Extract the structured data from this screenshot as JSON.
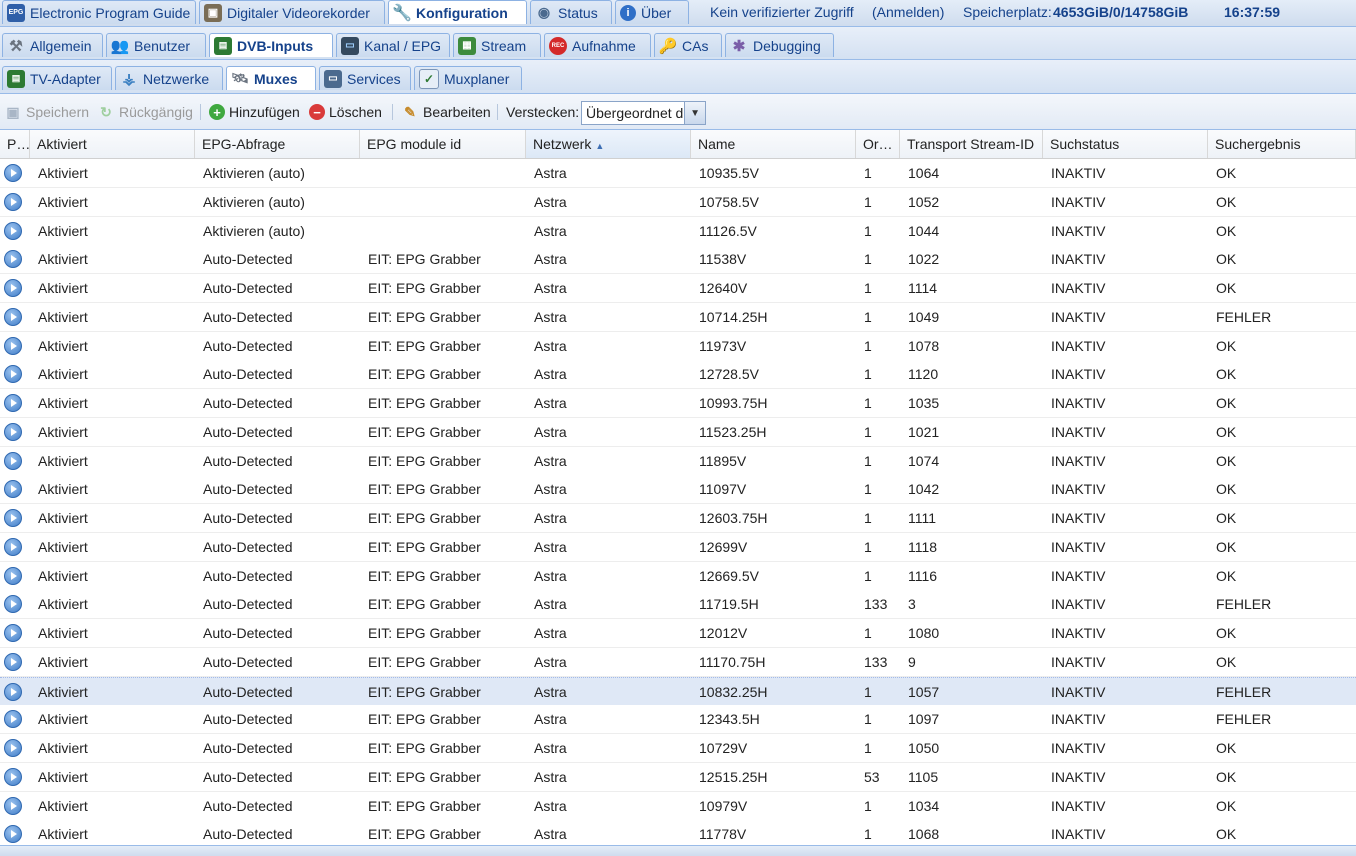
{
  "topbar": {
    "tabs": [
      {
        "label": "Electronic Program Guide",
        "icon": "epg-icon"
      },
      {
        "label": "Digitaler Videorekorder",
        "icon": "dvr-icon"
      },
      {
        "label": "Konfiguration",
        "icon": "wrench-icon",
        "active": true
      },
      {
        "label": "Status",
        "icon": "eye-icon"
      },
      {
        "label": "Über",
        "icon": "info-icon"
      }
    ],
    "access_text": "Kein verifizierter Zugriff",
    "login_link": "(Anmelden)",
    "storage_label": "Speicherplatz:",
    "storage_value": "4653GiB/0/14758GiB",
    "clock": "16:37:59"
  },
  "config_tabs": [
    {
      "label": "Allgemein",
      "icon": "tools-icon"
    },
    {
      "label": "Benutzer",
      "icon": "users-icon"
    },
    {
      "label": "DVB-Inputs",
      "icon": "dvb-card-icon",
      "active": true
    },
    {
      "label": "Kanal / EPG",
      "icon": "tv-icon"
    },
    {
      "label": "Stream",
      "icon": "stream-icon"
    },
    {
      "label": "Aufnahme",
      "icon": "rec-icon"
    },
    {
      "label": "CAs",
      "icon": "key-icon"
    },
    {
      "label": "Debugging",
      "icon": "bug-icon"
    }
  ],
  "dvb_tabs": [
    {
      "label": "TV-Adapter",
      "icon": "adapter-icon"
    },
    {
      "label": "Netzwerke",
      "icon": "antenna-icon"
    },
    {
      "label": "Muxes",
      "icon": "satellite-icon",
      "active": true
    },
    {
      "label": "Services",
      "icon": "services-icon"
    },
    {
      "label": "Muxplaner",
      "icon": "calendar-icon"
    }
  ],
  "toolbar": {
    "save": "Speichern",
    "undo": "Rückgängig",
    "add": "Hinzufügen",
    "delete": "Löschen",
    "edit": "Bearbeiten",
    "hide_label": "Verstecken:",
    "hide_value": "Übergeordnet d"
  },
  "columns": [
    "P…",
    "Aktiviert",
    "EPG-Abfrage",
    "EPG module id",
    "Netzwerk",
    "Name",
    "Or…",
    "Transport Stream-ID",
    "Suchstatus",
    "Suchergebnis"
  ],
  "sorted_column_index": 4,
  "rows": [
    [
      "Aktiviert",
      "Aktivieren (auto)",
      "",
      "Astra",
      "10935.5V",
      "1",
      "1064",
      "INAKTIV",
      "OK"
    ],
    [
      "Aktiviert",
      "Aktivieren (auto)",
      "",
      "Astra",
      "10758.5V",
      "1",
      "1052",
      "INAKTIV",
      "OK"
    ],
    [
      "Aktiviert",
      "Aktivieren (auto)",
      "",
      "Astra",
      "11126.5V",
      "1",
      "1044",
      "INAKTIV",
      "OK"
    ],
    [
      "Aktiviert",
      "Auto-Detected",
      "EIT: EPG Grabber",
      "Astra",
      "11538V",
      "1",
      "1022",
      "INAKTIV",
      "OK"
    ],
    [
      "Aktiviert",
      "Auto-Detected",
      "EIT: EPG Grabber",
      "Astra",
      "12640V",
      "1",
      "1114",
      "INAKTIV",
      "OK"
    ],
    [
      "Aktiviert",
      "Auto-Detected",
      "EIT: EPG Grabber",
      "Astra",
      "10714.25H",
      "1",
      "1049",
      "INAKTIV",
      "FEHLER"
    ],
    [
      "Aktiviert",
      "Auto-Detected",
      "EIT: EPG Grabber",
      "Astra",
      "11973V",
      "1",
      "1078",
      "INAKTIV",
      "OK"
    ],
    [
      "Aktiviert",
      "Auto-Detected",
      "EIT: EPG Grabber",
      "Astra",
      "12728.5V",
      "1",
      "1120",
      "INAKTIV",
      "OK"
    ],
    [
      "Aktiviert",
      "Auto-Detected",
      "EIT: EPG Grabber",
      "Astra",
      "10993.75H",
      "1",
      "1035",
      "INAKTIV",
      "OK"
    ],
    [
      "Aktiviert",
      "Auto-Detected",
      "EIT: EPG Grabber",
      "Astra",
      "11523.25H",
      "1",
      "1021",
      "INAKTIV",
      "OK"
    ],
    [
      "Aktiviert",
      "Auto-Detected",
      "EIT: EPG Grabber",
      "Astra",
      "11895V",
      "1",
      "1074",
      "INAKTIV",
      "OK"
    ],
    [
      "Aktiviert",
      "Auto-Detected",
      "EIT: EPG Grabber",
      "Astra",
      "11097V",
      "1",
      "1042",
      "INAKTIV",
      "OK"
    ],
    [
      "Aktiviert",
      "Auto-Detected",
      "EIT: EPG Grabber",
      "Astra",
      "12603.75H",
      "1",
      "1111",
      "INAKTIV",
      "OK"
    ],
    [
      "Aktiviert",
      "Auto-Detected",
      "EIT: EPG Grabber",
      "Astra",
      "12699V",
      "1",
      "1118",
      "INAKTIV",
      "OK"
    ],
    [
      "Aktiviert",
      "Auto-Detected",
      "EIT: EPG Grabber",
      "Astra",
      "12669.5V",
      "1",
      "1116",
      "INAKTIV",
      "OK"
    ],
    [
      "Aktiviert",
      "Auto-Detected",
      "EIT: EPG Grabber",
      "Astra",
      "11719.5H",
      "133",
      "3",
      "INAKTIV",
      "FEHLER"
    ],
    [
      "Aktiviert",
      "Auto-Detected",
      "EIT: EPG Grabber",
      "Astra",
      "12012V",
      "1",
      "1080",
      "INAKTIV",
      "OK"
    ],
    [
      "Aktiviert",
      "Auto-Detected",
      "EIT: EPG Grabber",
      "Astra",
      "11170.75H",
      "133",
      "9",
      "INAKTIV",
      "OK"
    ],
    [
      "Aktiviert",
      "Auto-Detected",
      "EIT: EPG Grabber",
      "Astra",
      "10832.25H",
      "1",
      "1057",
      "INAKTIV",
      "FEHLER"
    ],
    [
      "Aktiviert",
      "Auto-Detected",
      "EIT: EPG Grabber",
      "Astra",
      "12343.5H",
      "1",
      "1097",
      "INAKTIV",
      "FEHLER"
    ],
    [
      "Aktiviert",
      "Auto-Detected",
      "EIT: EPG Grabber",
      "Astra",
      "10729V",
      "1",
      "1050",
      "INAKTIV",
      "OK"
    ],
    [
      "Aktiviert",
      "Auto-Detected",
      "EIT: EPG Grabber",
      "Astra",
      "12515.25H",
      "53",
      "1105",
      "INAKTIV",
      "OK"
    ],
    [
      "Aktiviert",
      "Auto-Detected",
      "EIT: EPG Grabber",
      "Astra",
      "10979V",
      "1",
      "1034",
      "INAKTIV",
      "OK"
    ],
    [
      "Aktiviert",
      "Auto-Detected",
      "EIT: EPG Grabber",
      "Astra",
      "11778V",
      "1",
      "1068",
      "INAKTIV",
      "OK"
    ]
  ],
  "selected_row_index": 18,
  "colors": {
    "accent": "#15428b",
    "border": "#99bbe8",
    "selection": "#dfe8f6"
  }
}
